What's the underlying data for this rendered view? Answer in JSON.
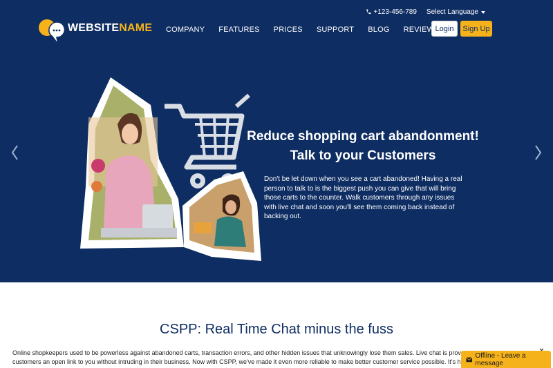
{
  "header": {
    "phone": "+123-456-789",
    "language_label": "Select Language",
    "logo": {
      "part1": "WEBSITE",
      "part2": "NAME"
    },
    "nav": [
      "COMPANY",
      "FEATURES",
      "PRICES",
      "SUPPORT",
      "BLOG",
      "REVIEW"
    ],
    "login_label": "Login",
    "signup_label": "Sign Up"
  },
  "hero": {
    "title_line1": "Reduce shopping cart abandonment!",
    "title_line2": "Talk to your Customers",
    "body_line1": "Don't be let down when you see a cart abandoned! Having a real",
    "body_line2": "person to talk to is the biggest push you can give that will bring",
    "body_line3": "those carts to the counter. Walk customers through any issues",
    "body_line4": "with live chat and soon you'll see them coming back instead of",
    "body_line5": "backing out."
  },
  "section": {
    "title": "CSPP: Real Time Chat minus the fuss",
    "line1": "Online shopkeepers used to be powerless against abandoned carts, transaction errors, and other hidden issues that unknowingly lose them sales. Live chat is proven to r",
    "line2": "customers an open link to you without intruding in their business. Now with CSPP, we've made it even more reliable to make better customer service possible. It's hassle fr"
  },
  "chat_widget": {
    "label": "Offline - Leave a message"
  },
  "colors": {
    "navy": "#0e2d62",
    "accent": "#f5b21b",
    "white": "#ffffff"
  },
  "icons": [
    "phone-icon",
    "caret-down-icon",
    "chat-bubble-logo-icon",
    "chevron-left-icon",
    "chevron-right-icon",
    "shopping-cart-icon",
    "envelope-icon",
    "close-icon"
  ]
}
